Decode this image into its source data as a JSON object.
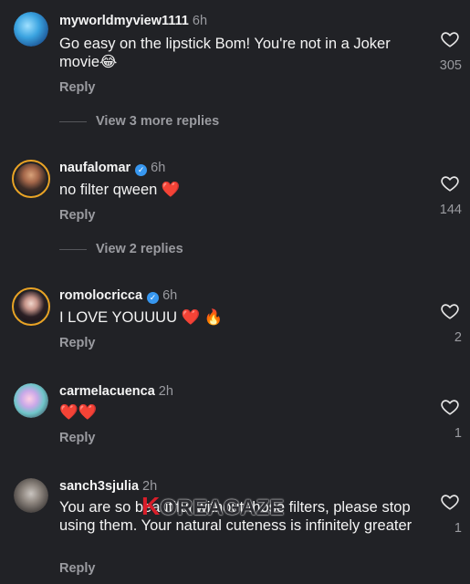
{
  "comments": [
    {
      "username": "myworldmyview1111",
      "time": "6h",
      "text": "Go easy on the lipstick Bom! You're not in a Joker movie😂",
      "reply": "Reply",
      "likes": "305",
      "view_replies": "View 3 more replies",
      "verified": false
    },
    {
      "username": "naufalomar",
      "time": "6h",
      "text": "no filter qween ❤️",
      "reply": "Reply",
      "likes": "144",
      "view_replies": "View 2 replies",
      "verified": true
    },
    {
      "username": "romolocricca",
      "time": "6h",
      "text": "I LOVE YOUUUU ❤️ 🔥",
      "reply": "Reply",
      "likes": "2",
      "verified": true
    },
    {
      "username": "carmelacuenca",
      "time": "2h",
      "text": "❤️❤️",
      "reply": "Reply",
      "likes": "1",
      "verified": false
    },
    {
      "username": "sanch3sjulia",
      "time": "2h",
      "text": "You are so beautiful without those filters, please stop using them. Your natural cuteness is infinitely greater",
      "reply": "Reply",
      "likes": "1",
      "verified": false
    }
  ],
  "watermark": {
    "k": "K",
    "rest": "OREAGAZE"
  },
  "colors": {
    "background": "#212226",
    "secondary_text": "#9a9ba0",
    "verified": "#3797f0",
    "heart_emoji": "#e8262f"
  },
  "icons": {
    "like": "heart-outline-icon",
    "verified": "verified-badge-icon"
  }
}
